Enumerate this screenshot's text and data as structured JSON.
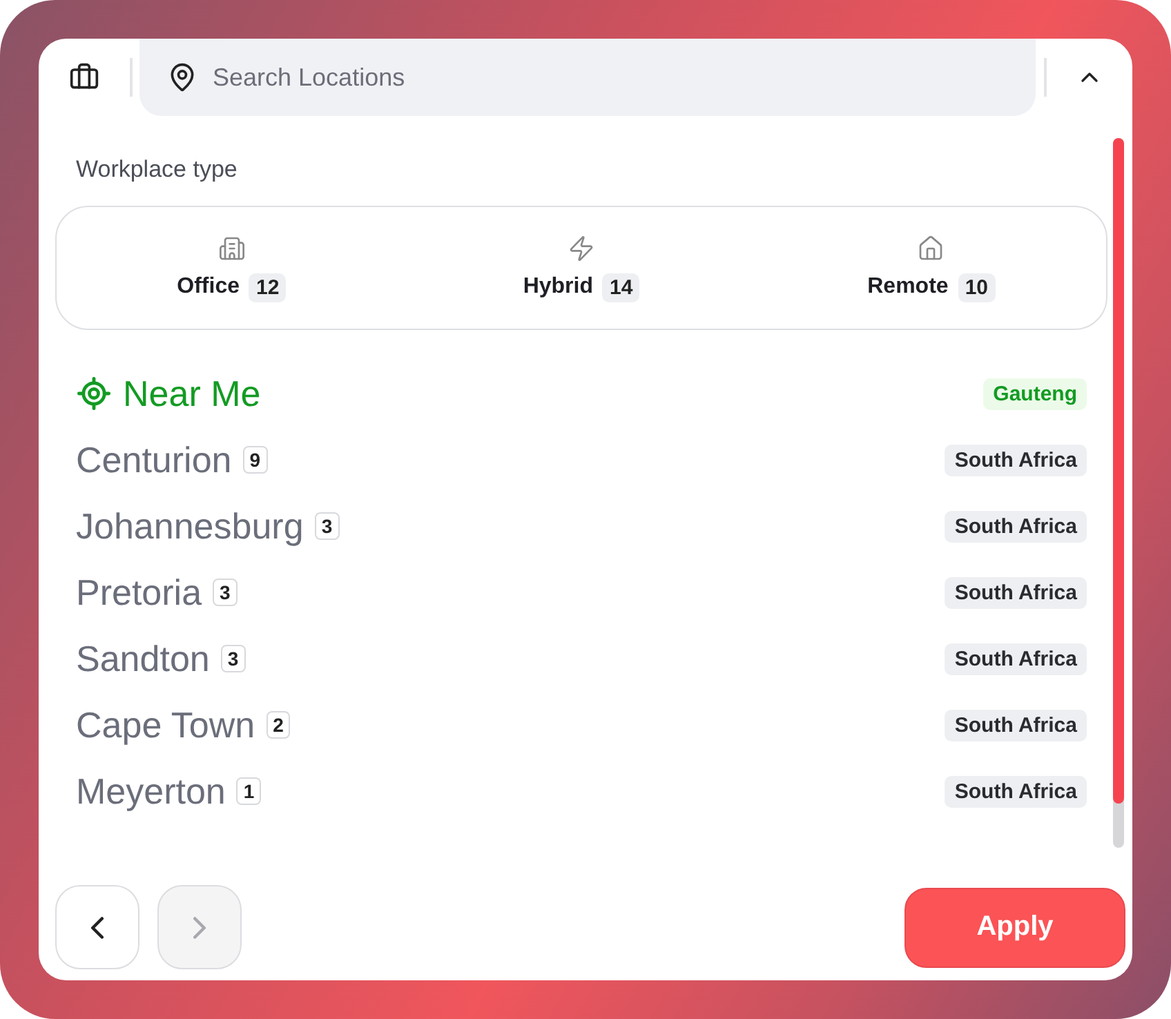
{
  "search": {
    "placeholder": "Search Locations"
  },
  "workplace": {
    "title": "Workplace type",
    "options": [
      {
        "kind": "office",
        "label": "Office",
        "count": "12"
      },
      {
        "kind": "hybrid",
        "label": "Hybrid",
        "count": "14"
      },
      {
        "kind": "remote",
        "label": "Remote",
        "count": "10"
      }
    ]
  },
  "locations": [
    {
      "kind": "near_me",
      "name": "Near Me",
      "region": "Gauteng"
    },
    {
      "kind": "place",
      "name": "Centurion",
      "count": "9",
      "region": "South Africa"
    },
    {
      "kind": "place",
      "name": "Johannesburg",
      "count": "3",
      "region": "South Africa"
    },
    {
      "kind": "place",
      "name": "Pretoria",
      "count": "3",
      "region": "South Africa"
    },
    {
      "kind": "place",
      "name": "Sandton",
      "count": "3",
      "region": "South Africa"
    },
    {
      "kind": "place",
      "name": "Cape Town",
      "count": "2",
      "region": "South Africa"
    },
    {
      "kind": "place",
      "name": "Meyerton",
      "count": "1",
      "region": "South Africa"
    }
  ],
  "footer": {
    "back_disabled": false,
    "next_disabled": true,
    "apply": "Apply"
  }
}
